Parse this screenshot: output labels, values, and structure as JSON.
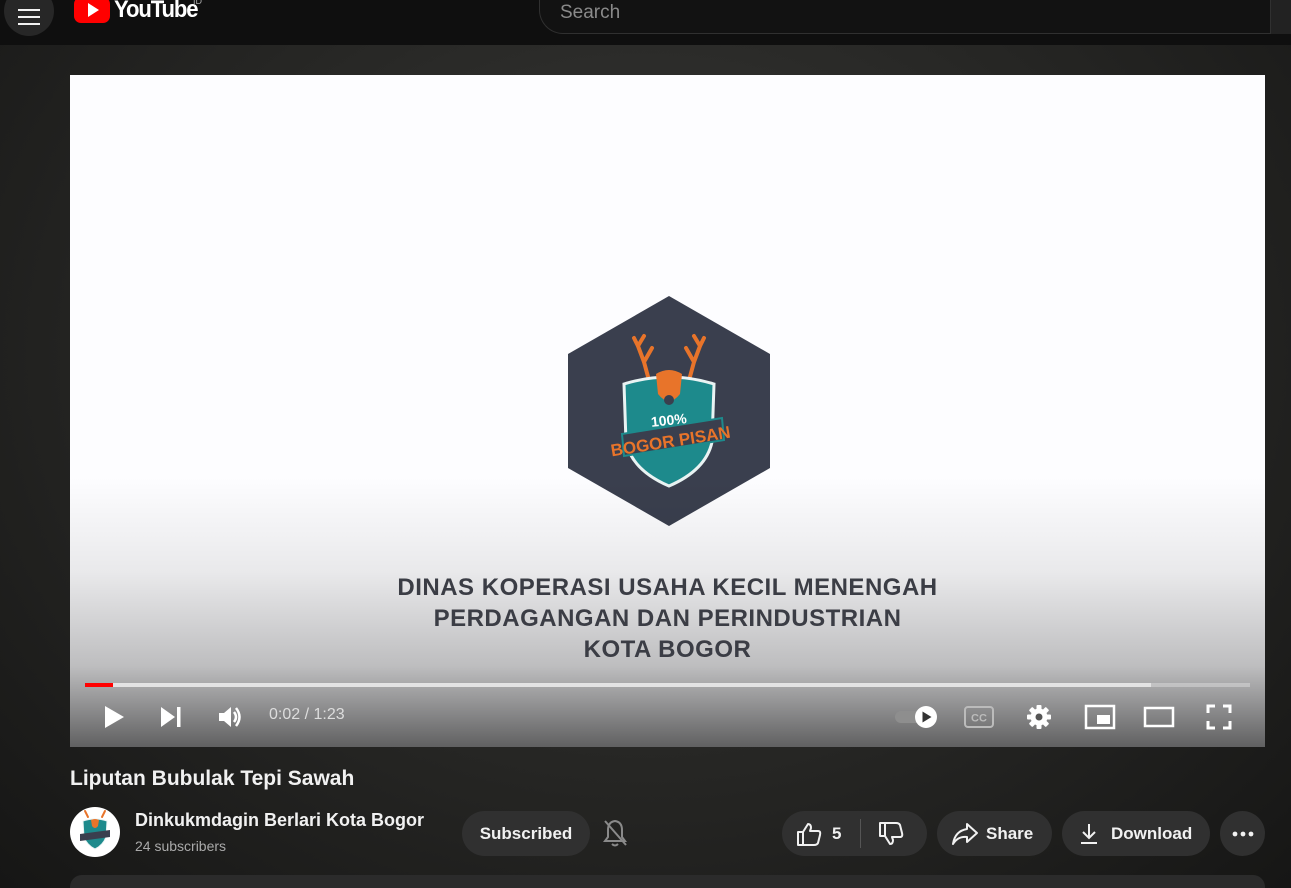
{
  "header": {
    "logo_text": "YouTube",
    "country_code": "ID",
    "search_placeholder": "Search"
  },
  "player": {
    "video_overlay_text": [
      "DINAS KOPERASI USAHA KECIL MENENGAH",
      "PERDAGANGAN DAN PERINDUSTRIAN",
      "KOTA BOGOR"
    ],
    "emblem_text": {
      "percent": "100%",
      "slogan": "BOGOR PISAN"
    },
    "time_current": "0:02",
    "time_separator": " / ",
    "time_duration": "1:23",
    "progress_fraction": 0.024,
    "buffered_fraction": 0.915,
    "autoplay_on": true
  },
  "video": {
    "title": "Liputan Bubulak Tepi Sawah"
  },
  "channel": {
    "name": "Dinkukmdagin Berlari Kota Bogor",
    "subscribers": "24 subscribers",
    "subscribe_label": "Subscribed"
  },
  "actions": {
    "like_count": "5",
    "share_label": "Share",
    "download_label": "Download"
  },
  "colors": {
    "accent": "#ff0000",
    "emblem_hex": "#3a3f4e",
    "emblem_teal": "#1d8a8c",
    "emblem_orange": "#e8742a"
  }
}
